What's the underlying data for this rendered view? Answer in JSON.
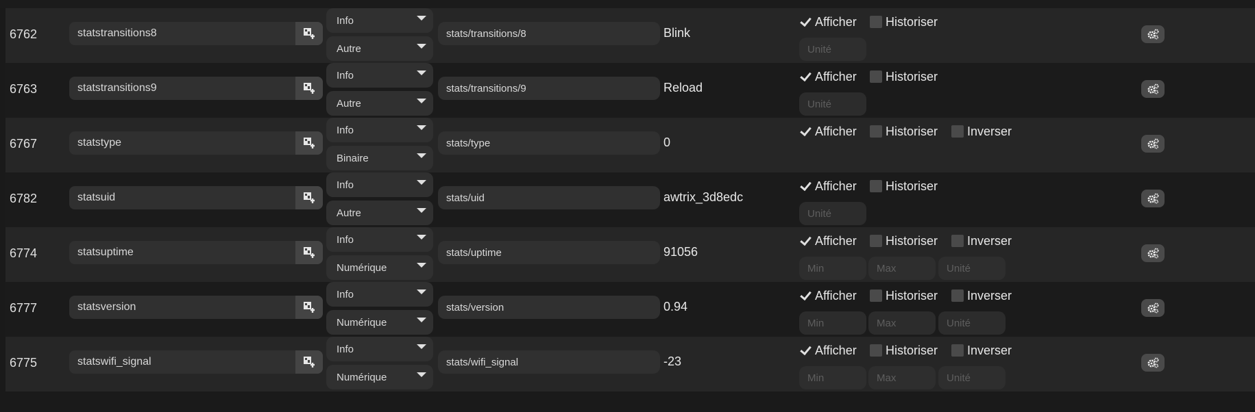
{
  "rows": [
    {
      "id": "6762",
      "name": "statstransitions8",
      "type": "Info",
      "subtype": "Autre",
      "topic": "stats/transitions/8",
      "value": "Blink",
      "afficher": "Afficher",
      "afficher_checked": true,
      "historiser": "Historiser",
      "historiser_checked": false,
      "inverser": null,
      "inputs": [
        "Unité"
      ]
    },
    {
      "id": "6763",
      "name": "statstransitions9",
      "type": "Info",
      "subtype": "Autre",
      "topic": "stats/transitions/9",
      "value": "Reload",
      "afficher": "Afficher",
      "afficher_checked": true,
      "historiser": "Historiser",
      "historiser_checked": false,
      "inverser": null,
      "inputs": [
        "Unité"
      ]
    },
    {
      "id": "6767",
      "name": "statstype",
      "type": "Info",
      "subtype": "Binaire",
      "topic": "stats/type",
      "value": "0",
      "afficher": "Afficher",
      "afficher_checked": true,
      "historiser": "Historiser",
      "historiser_checked": false,
      "inverser": "Inverser",
      "inputs": []
    },
    {
      "id": "6782",
      "name": "statsuid",
      "type": "Info",
      "subtype": "Autre",
      "topic": "stats/uid",
      "value": "awtrix_3d8edc",
      "afficher": "Afficher",
      "afficher_checked": true,
      "historiser": "Historiser",
      "historiser_checked": false,
      "inverser": null,
      "inputs": [
        "Unité"
      ]
    },
    {
      "id": "6774",
      "name": "statsuptime",
      "type": "Info",
      "subtype": "Numérique",
      "topic": "stats/uptime",
      "value": "91056",
      "afficher": "Afficher",
      "afficher_checked": true,
      "historiser": "Historiser",
      "historiser_checked": false,
      "inverser": "Inverser",
      "inputs": [
        "Min",
        "Max",
        "Unité"
      ]
    },
    {
      "id": "6777",
      "name": "statsversion",
      "type": "Info",
      "subtype": "Numérique",
      "topic": "stats/version",
      "value": "0.94",
      "afficher": "Afficher",
      "afficher_checked": true,
      "historiser": "Historiser",
      "historiser_checked": false,
      "inverser": "Inverser",
      "inputs": [
        "Min",
        "Max",
        "Unité"
      ]
    },
    {
      "id": "6775",
      "name": "statswifi_signal",
      "type": "Info",
      "subtype": "Numérique",
      "topic": "stats/wifi_signal",
      "value": "-23",
      "afficher": "Afficher",
      "afficher_checked": true,
      "historiser": "Historiser",
      "historiser_checked": false,
      "inverser": "Inverser",
      "inputs": [
        "Min",
        "Max",
        "Unité"
      ]
    }
  ],
  "icons": {
    "name_button": "map-edit-icon",
    "row_action": "gears-icon"
  },
  "colors": {
    "row_odd": "#262626",
    "row_even": "#1b1b1b",
    "field_bg": "#303030",
    "button_bg": "#444444"
  }
}
